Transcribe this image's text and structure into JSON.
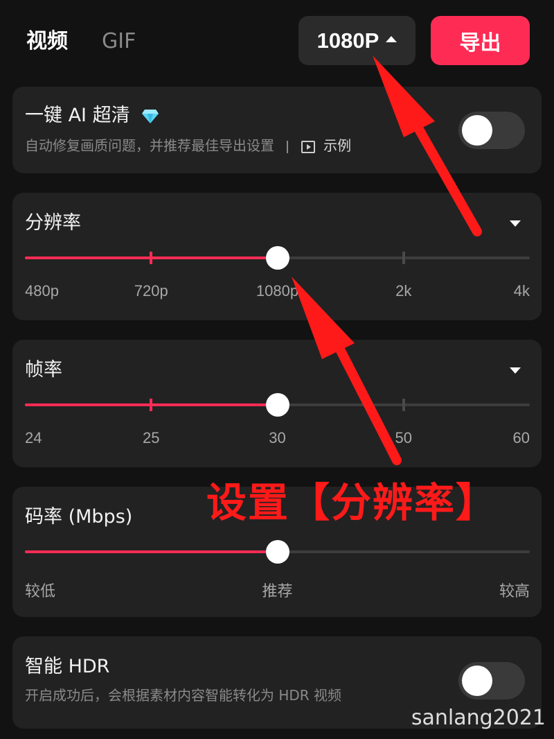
{
  "header": {
    "tabs": [
      {
        "label": "视频",
        "selected": true
      },
      {
        "label": "GIF",
        "selected": false
      }
    ],
    "resolution_button": "1080P",
    "export_label": "导出"
  },
  "ai_enhance": {
    "title": "一键 AI 超清",
    "subtitle": "自动修复画质问题，并推荐最佳导出设置",
    "example_label": "示例",
    "enabled": false
  },
  "resolution": {
    "title": "分辨率",
    "ticks": [
      "480p",
      "720p",
      "1080p",
      "2k",
      "4k"
    ],
    "selected_index": 2
  },
  "frame_rate": {
    "title": "帧率",
    "ticks": [
      "24",
      "25",
      "30",
      "50",
      "60"
    ],
    "selected_index": 2
  },
  "bitrate": {
    "title": "码率 (Mbps)",
    "labels": [
      "较低",
      "推荐",
      "较高"
    ],
    "value_fraction": 0.5
  },
  "hdr": {
    "title": "智能 HDR",
    "subtitle": "开启成功后，会根据素材内容智能转化为 HDR 视频",
    "enabled": false
  },
  "annotation_text": "设置【分辨率】",
  "watermark": "sanlang2021",
  "colors": {
    "accent": "#fe2c55",
    "annotation": "#ff1a1a",
    "card_bg": "#222222",
    "page_bg": "#121212"
  }
}
